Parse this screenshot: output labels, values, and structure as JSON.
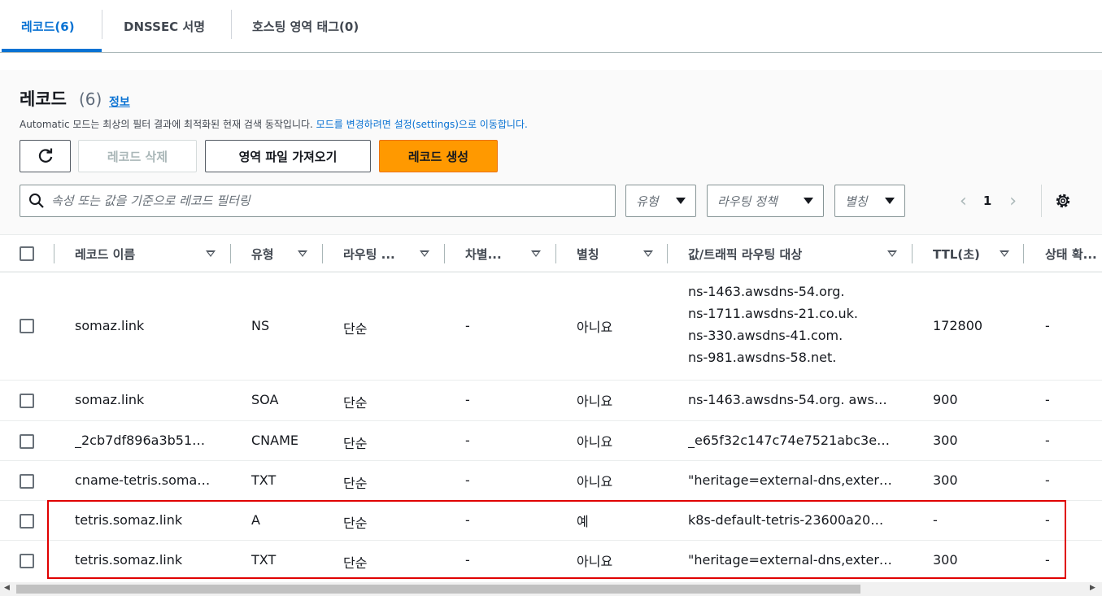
{
  "tabs": [
    {
      "label": "레코드(6)"
    },
    {
      "label": "DNSSEC 서명"
    },
    {
      "label": "호스팅 영역 태그(0)"
    }
  ],
  "header": {
    "title": "레코드",
    "count": "(6)",
    "info_link": "정보",
    "description": "Automatic 모드는 최상의 필터 결과에 최적화된 현재 검색 동작입니다. ",
    "description_link": "모드를 변경하려면 설정(settings)으로 이동합니다."
  },
  "toolbar": {
    "delete_label": "레코드 삭제",
    "import_label": "영역 파일 가져오기",
    "create_label": "레코드 생성"
  },
  "filter": {
    "search_placeholder": "속성 또는 값을 기준으로 레코드 필터링",
    "type_dropdown": "유형",
    "routing_dropdown": "라우팅 정책",
    "alias_dropdown": "별칭",
    "page": "1"
  },
  "table": {
    "columns": [
      "레코드 이름",
      "유형",
      "라우팅 ...",
      "차별...",
      "별칭",
      "값/트래픽 라우팅 대상",
      "TTL(초)",
      "상태 확..."
    ],
    "rows": [
      {
        "name": "somaz.link",
        "type": "NS",
        "routing": "단순",
        "diff": "-",
        "alias": "아니요",
        "value": [
          "ns-1463.awsdns-54.org.",
          "ns-1711.awsdns-21.co.uk.",
          "ns-330.awsdns-41.com.",
          "ns-981.awsdns-58.net."
        ],
        "ttl": "172800",
        "health": "-"
      },
      {
        "name": "somaz.link",
        "type": "SOA",
        "routing": "단순",
        "diff": "-",
        "alias": "아니요",
        "value": [
          "ns-1463.awsdns-54.org. aws…"
        ],
        "ttl": "900",
        "health": "-"
      },
      {
        "name": "_2cb7df896a3b51…",
        "type": "CNAME",
        "routing": "단순",
        "diff": "-",
        "alias": "아니요",
        "value": [
          "_e65f32c147c74e7521abc3e…"
        ],
        "ttl": "300",
        "health": "-"
      },
      {
        "name": "cname-tetris.soma…",
        "type": "TXT",
        "routing": "단순",
        "diff": "-",
        "alias": "아니요",
        "value": [
          "\"heritage=external-dns,exter…"
        ],
        "ttl": "300",
        "health": "-"
      },
      {
        "name": "tetris.somaz.link",
        "type": "A",
        "routing": "단순",
        "diff": "-",
        "alias": "예",
        "value": [
          "k8s-default-tetris-23600a20…"
        ],
        "ttl": "-",
        "health": "-"
      },
      {
        "name": "tetris.somaz.link",
        "type": "TXT",
        "routing": "단순",
        "diff": "-",
        "alias": "아니요",
        "value": [
          "\"heritage=external-dns,exter…"
        ],
        "ttl": "300",
        "health": "-"
      }
    ]
  },
  "colors": {
    "accent": "#0972d3",
    "primary_button": "#ff9900",
    "highlight_box": "#e00000"
  }
}
